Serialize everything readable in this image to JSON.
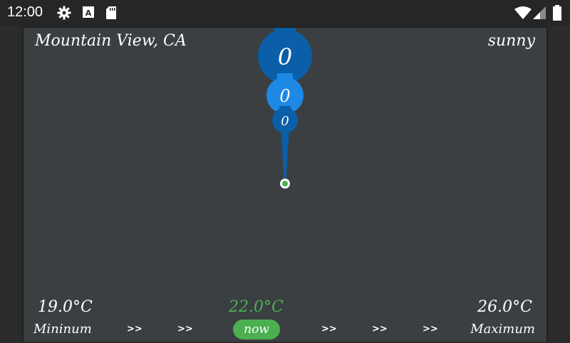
{
  "status_bar": {
    "time": "12:00",
    "icons": [
      "gear-icon",
      "a-box-icon",
      "sd-card-icon",
      "wifi-icon",
      "cell-signal-icon",
      "battery-icon"
    ]
  },
  "header": {
    "location": "Mountain View, CA",
    "condition": "sunny"
  },
  "forecast_bubbles": [
    {
      "label": "0"
    },
    {
      "label": "0"
    },
    {
      "label": "0"
    }
  ],
  "temperatures": {
    "min": "19.0°C",
    "current": "22.0°C",
    "max": "26.0°C"
  },
  "scale": {
    "min_label": "Mininum",
    "max_label": "Maximum",
    "now_label": "now",
    "arrow": ">>"
  },
  "colors": {
    "background": "#3b3f42",
    "bubble_dark": "#0a5fa8",
    "bubble_light": "#1e88e5",
    "accent_green": "#4caf50"
  }
}
